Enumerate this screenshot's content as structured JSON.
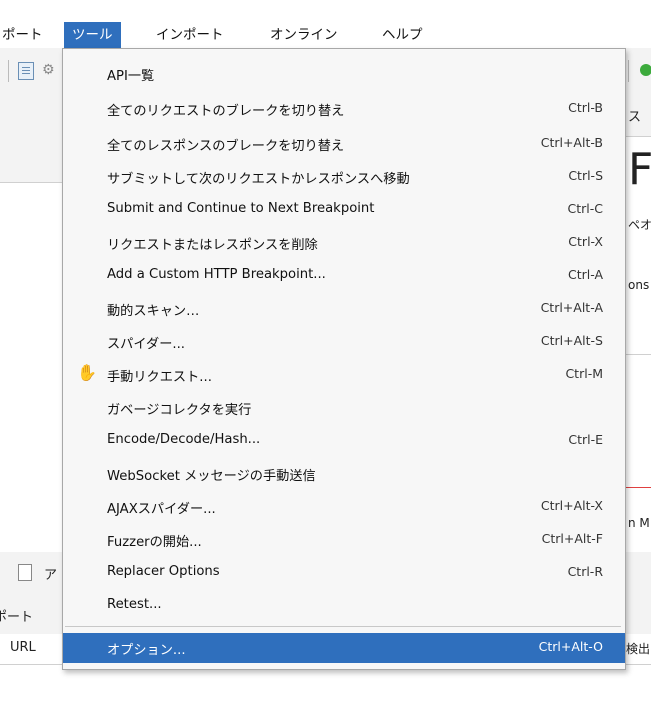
{
  "menubar": {
    "report": "ポート",
    "tools": "ツール",
    "import": "インポート",
    "online": "オンライン",
    "help": "ヘルプ"
  },
  "background": {
    "right_tab": "ス",
    "right_big": "F",
    "right_pe": "ペオ",
    "right_ons": "ons",
    "right_m": "n M.",
    "bottom_tab": "ア",
    "bottom_report": "ポート",
    "url_header": "URL",
    "detect_header": "検出."
  },
  "menu": {
    "items": [
      {
        "label": "API一覧",
        "shortcut": ""
      },
      {
        "label": "全てのリクエストのブレークを切り替え",
        "shortcut": "Ctrl-B"
      },
      {
        "label": "全てのレスポンスのブレークを切り替え",
        "shortcut": "Ctrl+Alt-B"
      },
      {
        "label": "サブミットして次のリクエストかレスポンスへ移動",
        "shortcut": "Ctrl-S"
      },
      {
        "label": "Submit and Continue to Next Breakpoint",
        "shortcut": "Ctrl-C"
      },
      {
        "label": "リクエストまたはレスポンスを削除",
        "shortcut": "Ctrl-X"
      },
      {
        "label": "Add a Custom HTTP Breakpoint...",
        "shortcut": "Ctrl-A"
      },
      {
        "label": "動的スキャン…",
        "shortcut": "Ctrl+Alt-A"
      },
      {
        "label": "スパイダー...",
        "shortcut": "Ctrl+Alt-S"
      },
      {
        "label": "手動リクエスト...",
        "shortcut": "Ctrl-M",
        "icon": "hand-icon"
      },
      {
        "label": "ガベージコレクタを実行",
        "shortcut": ""
      },
      {
        "label": "Encode/Decode/Hash...",
        "shortcut": "Ctrl-E"
      },
      {
        "label": "WebSocket メッセージの手動送信",
        "shortcut": ""
      },
      {
        "label": "AJAXスパイダー...",
        "shortcut": "Ctrl+Alt-X"
      },
      {
        "label": "Fuzzerの開始...",
        "shortcut": "Ctrl+Alt-F"
      },
      {
        "label": "Replacer Options",
        "shortcut": "Ctrl-R"
      },
      {
        "label": "Retest...",
        "shortcut": ""
      },
      {
        "label": "オプション...",
        "shortcut": "Ctrl+Alt-O",
        "highlighted": true
      }
    ]
  },
  "colors": {
    "highlight": "#2f6fbd",
    "menu_bg": "#f7f7f7"
  }
}
